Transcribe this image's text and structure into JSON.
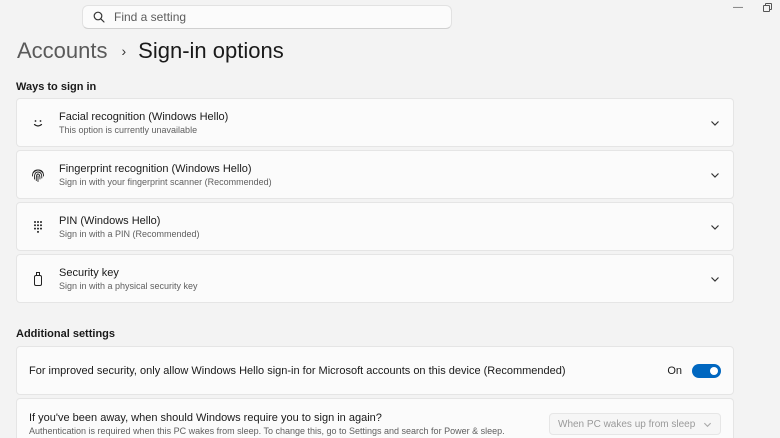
{
  "window": {
    "minimize_icon": "minimize-icon",
    "restore_icon": "restore-icon"
  },
  "search": {
    "placeholder": "Find a setting",
    "icon": "search-icon"
  },
  "breadcrumb": {
    "parent": "Accounts",
    "separator": "›",
    "current": "Sign-in options"
  },
  "ways": {
    "heading": "Ways to sign in",
    "items": [
      {
        "title": "Facial recognition (Windows Hello)",
        "subtitle": "This option is currently unavailable",
        "icon": "face-icon"
      },
      {
        "title": "Fingerprint recognition (Windows Hello)",
        "subtitle": "Sign in with your fingerprint scanner (Recommended)",
        "icon": "fingerprint-icon"
      },
      {
        "title": "PIN (Windows Hello)",
        "subtitle": "Sign in with a PIN (Recommended)",
        "icon": "pin-keypad-icon"
      },
      {
        "title": "Security key",
        "subtitle": "Sign in with a physical security key",
        "icon": "usb-key-icon"
      }
    ]
  },
  "additional": {
    "heading": "Additional settings",
    "hello_only": {
      "text": "For improved security, only allow Windows Hello sign-in for Microsoft accounts on this device (Recommended)",
      "state_label": "On",
      "enabled": true
    },
    "require_signin": {
      "title": "If you've been away, when should Windows require you to sign in again?",
      "subtitle": "Authentication is required when this PC wakes from sleep. To change this, go to Settings and search for Power & sleep.",
      "dropdown_value": "When PC wakes up from sleep",
      "disabled": true
    }
  },
  "colors": {
    "accent": "#0067c0",
    "background": "#f3f3f3",
    "card": "#fbfbfb"
  }
}
